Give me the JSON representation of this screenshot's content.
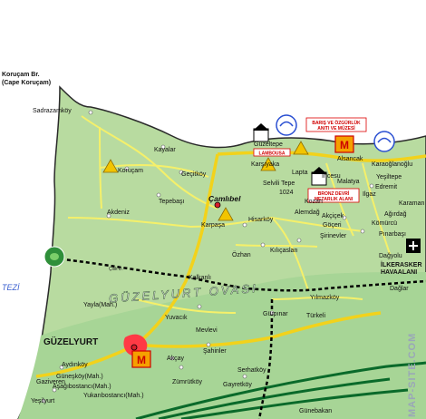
{
  "cape": {
    "line1": "Koruçam Br.",
    "line2": "(Cape Koruçam)"
  },
  "sea_label": "TEZİ",
  "region_label": "GÜZELYURT OVASI",
  "watermark": "MAP-SITE.COM",
  "towns": {
    "camlibel": "Çamlıbel",
    "guzelyurt": "GÜZELYURT"
  },
  "places": {
    "sadrazamkoy": "Sadrazamköy",
    "kayalar": "Kayalar",
    "korucam": "Koruçam",
    "gecitkoy": "Geçitköy",
    "tepebasi": "Tepebaşı",
    "akdeniz": "Akdeniz",
    "karsiyaka": "Karşıyaka",
    "lapta": "Lapta",
    "alsancak": "Alsancak",
    "karaoglanoglu": "Karaoğlanoğlu",
    "yesiltepe": "Yeşiltepe",
    "edremit": "Edremit",
    "karaman": "Karaman",
    "ilgaz": "Ilgaz",
    "malatya": "Malatya",
    "incesu": "İncesu",
    "guzeltepe": "Güzeltepe",
    "kozan": "Kozan",
    "selvili_tepe": "Selvili Tepe",
    "peak_height": "1024",
    "agirdag": "Ağırdağ",
    "alemdag": "Alemdağ",
    "akcicek": "Akçiçek",
    "gocen": "Göçeri",
    "sirinevler": "Şirinevler",
    "komurcu": "Kömürcü",
    "pinarbasi": "Pınarbaşı",
    "dagyolu": "Dağyolu",
    "ilkerasker": "İLKERASKER",
    "havaalani": "HAVAALANI",
    "karpasa": "Karpaşa",
    "hisarkoy": "Hisarköy",
    "ozhan": "Özhan",
    "kilicaslan": "Kılıçaslan",
    "cilik": "Çilik D.",
    "kalkanli": "Kalkanlı",
    "yilmazkoy": "Yılmazköy",
    "yayla": "Yayla(Mah.)",
    "yuvacik": "Yuvacık",
    "mevlevi": "Mevlevi",
    "gurpinar": "Gürpınar",
    "turkeli": "Türkeli",
    "sahinler": "Şahinler",
    "akcay": "Akçay",
    "zumrutkoy": "Zümrütköy",
    "serhatkoy": "Serhatköy",
    "gayretkoy": "Gayretköy",
    "aydinkoy": "Aydınköy",
    "guneskoy": "Güneşköy(Mah.)",
    "asagibostanci": "Aşağıbostancı(Mah.)",
    "yukaribostanci": "Yukarıbostancı(Mah.)",
    "gaziveren": "Gaziveren",
    "yesilyurt": "Yeşilyurt",
    "daglar": "Dağlar",
    "gunebakan": "Günebakan"
  },
  "boxes": {
    "lambousa": "LAMBOUSA",
    "museum_line1": "BARIŞ VE ÖZGÜRLÜK",
    "museum_line2": "ANITI VE MÜZESİ",
    "cemetery_line1": "BRONZ DEVRİ",
    "cemetery_line2": "MEZARLIK ALANI"
  },
  "icons": {
    "museum": "museum-M-icon",
    "temple": "ancient-temple-icon",
    "beach": "beach-umbrella-icon",
    "camp": "camping-tent-icon",
    "turtle": "turtle-icon",
    "airport": "airport-icon"
  },
  "colors": {
    "land": "#b8dba0",
    "plain": "#a7d596",
    "sea": "#ffffff",
    "road_main": "#f2d21b",
    "road_minor": "#f5f06a",
    "highway": "#0a6a2a",
    "border": "#000000",
    "town_marker": "#d91e2a",
    "urban": "#ff3a45",
    "label_red": "#d00000",
    "water_icon": "#2a4fd2"
  }
}
